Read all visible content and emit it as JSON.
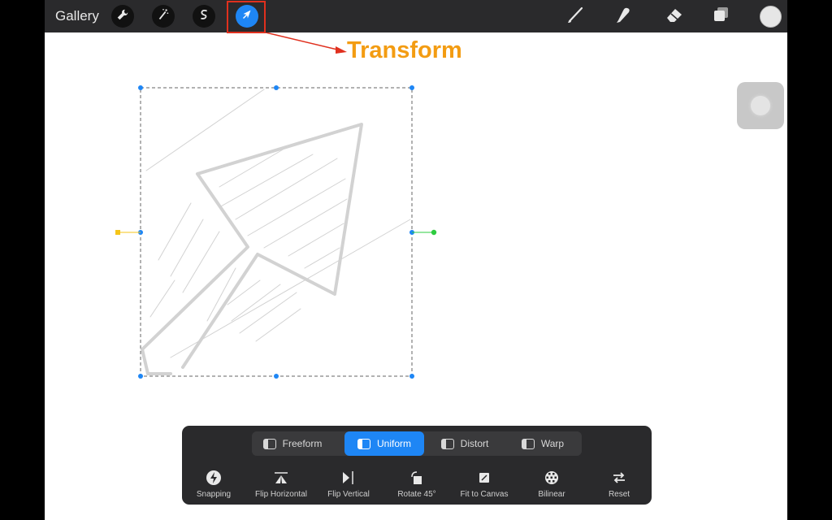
{
  "topbar": {
    "gallery_label": "Gallery",
    "left_tools": [
      {
        "name": "actions",
        "icon": "wrench-icon"
      },
      {
        "name": "adjustments",
        "icon": "magic-wand-icon"
      },
      {
        "name": "selection",
        "icon": "selection-s-icon"
      },
      {
        "name": "transform",
        "icon": "arrow-cursor-icon",
        "active": true
      }
    ],
    "right_tools": [
      {
        "name": "brush",
        "icon": "brush-icon"
      },
      {
        "name": "smudge",
        "icon": "smudge-icon"
      },
      {
        "name": "eraser",
        "icon": "eraser-icon"
      },
      {
        "name": "layers",
        "icon": "layers-icon"
      },
      {
        "name": "color",
        "icon": "color-swatch",
        "color": "#e6e6e6"
      }
    ]
  },
  "annotation": {
    "label": "Transform",
    "color": "#f39c12",
    "arrow_color": "#e0301e"
  },
  "transform_modes": [
    {
      "label": "Freeform",
      "selected": false
    },
    {
      "label": "Uniform",
      "selected": true
    },
    {
      "label": "Distort",
      "selected": false
    },
    {
      "label": "Warp",
      "selected": false
    }
  ],
  "transform_actions": [
    {
      "label": "Snapping",
      "icon": "lightning-icon"
    },
    {
      "label": "Flip Horizontal",
      "icon": "flip-horizontal-icon"
    },
    {
      "label": "Flip Vertical",
      "icon": "flip-vertical-icon"
    },
    {
      "label": "Rotate 45°",
      "icon": "rotate-icon"
    },
    {
      "label": "Fit to Canvas",
      "icon": "fit-canvas-icon"
    },
    {
      "label": "Bilinear",
      "icon": "bilinear-icon"
    },
    {
      "label": "Reset",
      "icon": "reset-icon"
    }
  ],
  "colors": {
    "accent": "#1e86f5",
    "toolbar_bg": "#2a2a2c",
    "handle_yellow": "#f5c518",
    "handle_green": "#2ecc40"
  }
}
